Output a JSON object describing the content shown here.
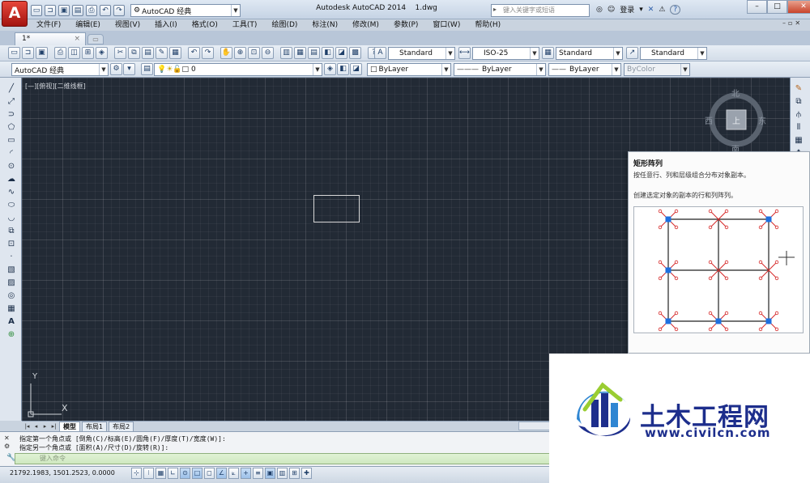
{
  "app": {
    "logo_letter": "A",
    "window_title": "Autodesk AutoCAD 2014",
    "file_name": "1.dwg",
    "workspace": "AutoCAD 经典",
    "search_placeholder": "键入关键字或短语",
    "login_label": "登录",
    "help_label": "?"
  },
  "qat_icons": [
    "new-icon",
    "open-icon",
    "save-icon",
    "saveas-icon",
    "print-icon",
    "undo-icon",
    "redo-icon"
  ],
  "menu": [
    "文件(F)",
    "编辑(E)",
    "视图(V)",
    "插入(I)",
    "格式(O)",
    "工具(T)",
    "绘图(D)",
    "标注(N)",
    "修改(M)",
    "参数(P)",
    "窗口(W)",
    "帮助(H)"
  ],
  "doc_tab": {
    "label": "1*",
    "close": "×"
  },
  "styles": {
    "text_style": "Standard",
    "dim_style": "ISO-25",
    "table_style": "Standard",
    "mleader_style": "Standard"
  },
  "layers": {
    "workspace": "AutoCAD 经典",
    "current_layer": "0",
    "color": "ByLayer",
    "linetype": "ByLayer",
    "lineweight": "ByLayer",
    "plotstyle": "ByColor"
  },
  "viewport": {
    "label": "[—][俯视][二维线框]",
    "viewcube": {
      "north": "北",
      "south": "南",
      "east": "东",
      "west": "西",
      "face": "上"
    },
    "ucs": {
      "x": "X",
      "y": "Y"
    }
  },
  "tooltip": {
    "title": "矩形阵列",
    "description": "按任意行、列和层级组合分布对象副本。",
    "detail": "创建选定对象的副本的行和列阵列。"
  },
  "layout_tabs": [
    "模型",
    "布局1",
    "布局2"
  ],
  "command": {
    "line1": "指定第一个角点或 [倒角(C)/标高(E)/圆角(F)/厚度(T)/宽度(W)]:",
    "line2": "指定另一个角点或 [面积(A)/尺寸(D)/旋转(R)]:",
    "input_placeholder": "键入命令"
  },
  "status": {
    "coordinates": "21792.1983, 1501.2523, 0.0000"
  },
  "watermark": {
    "name": "土木工程网",
    "url": "www.civilcn.com"
  },
  "colors": {
    "canvas": "#222a35",
    "grip_blue": "#1e6fe0",
    "grip_red": "#d62828",
    "watermark_blue": "#1d2e8c"
  }
}
